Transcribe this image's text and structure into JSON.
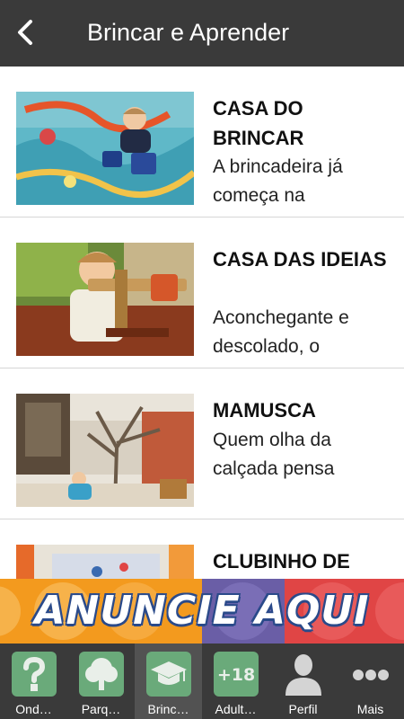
{
  "header": {
    "title": "Brincar e Aprender",
    "back_icon": "back-arrow-icon"
  },
  "items": [
    {
      "title": "CASA DO BRINCAR",
      "description": "A brincadeira já começa na"
    },
    {
      "title": "CASA DAS IDEIAS",
      "description": "Aconchegante e descolado, o"
    },
    {
      "title": "MAMUSCA",
      "description": "Quem olha da calçada pensa"
    },
    {
      "title": "CLUBINHO DE",
      "description": ""
    }
  ],
  "banner": {
    "text": "ANUNCIE AQUI"
  },
  "tabs": [
    {
      "label": "Ond…",
      "icon": "question-icon",
      "active": false
    },
    {
      "label": "Parq…",
      "icon": "tree-icon",
      "active": false
    },
    {
      "label": "Brinc…",
      "icon": "graduation-cap-icon",
      "active": true
    },
    {
      "label": "Adult…",
      "icon": "plus-18-icon",
      "active": false
    },
    {
      "label": "Perfil",
      "icon": "person-icon",
      "active": false
    },
    {
      "label": "Mais",
      "icon": "more-dots-icon",
      "active": false
    }
  ],
  "colors": {
    "header_bg": "#3a3a3a",
    "tab_icon_green": "#6aaa7a",
    "banner_orange": "#f39a1e",
    "banner_purple": "#6a5ea6",
    "banner_red": "#e04545"
  }
}
